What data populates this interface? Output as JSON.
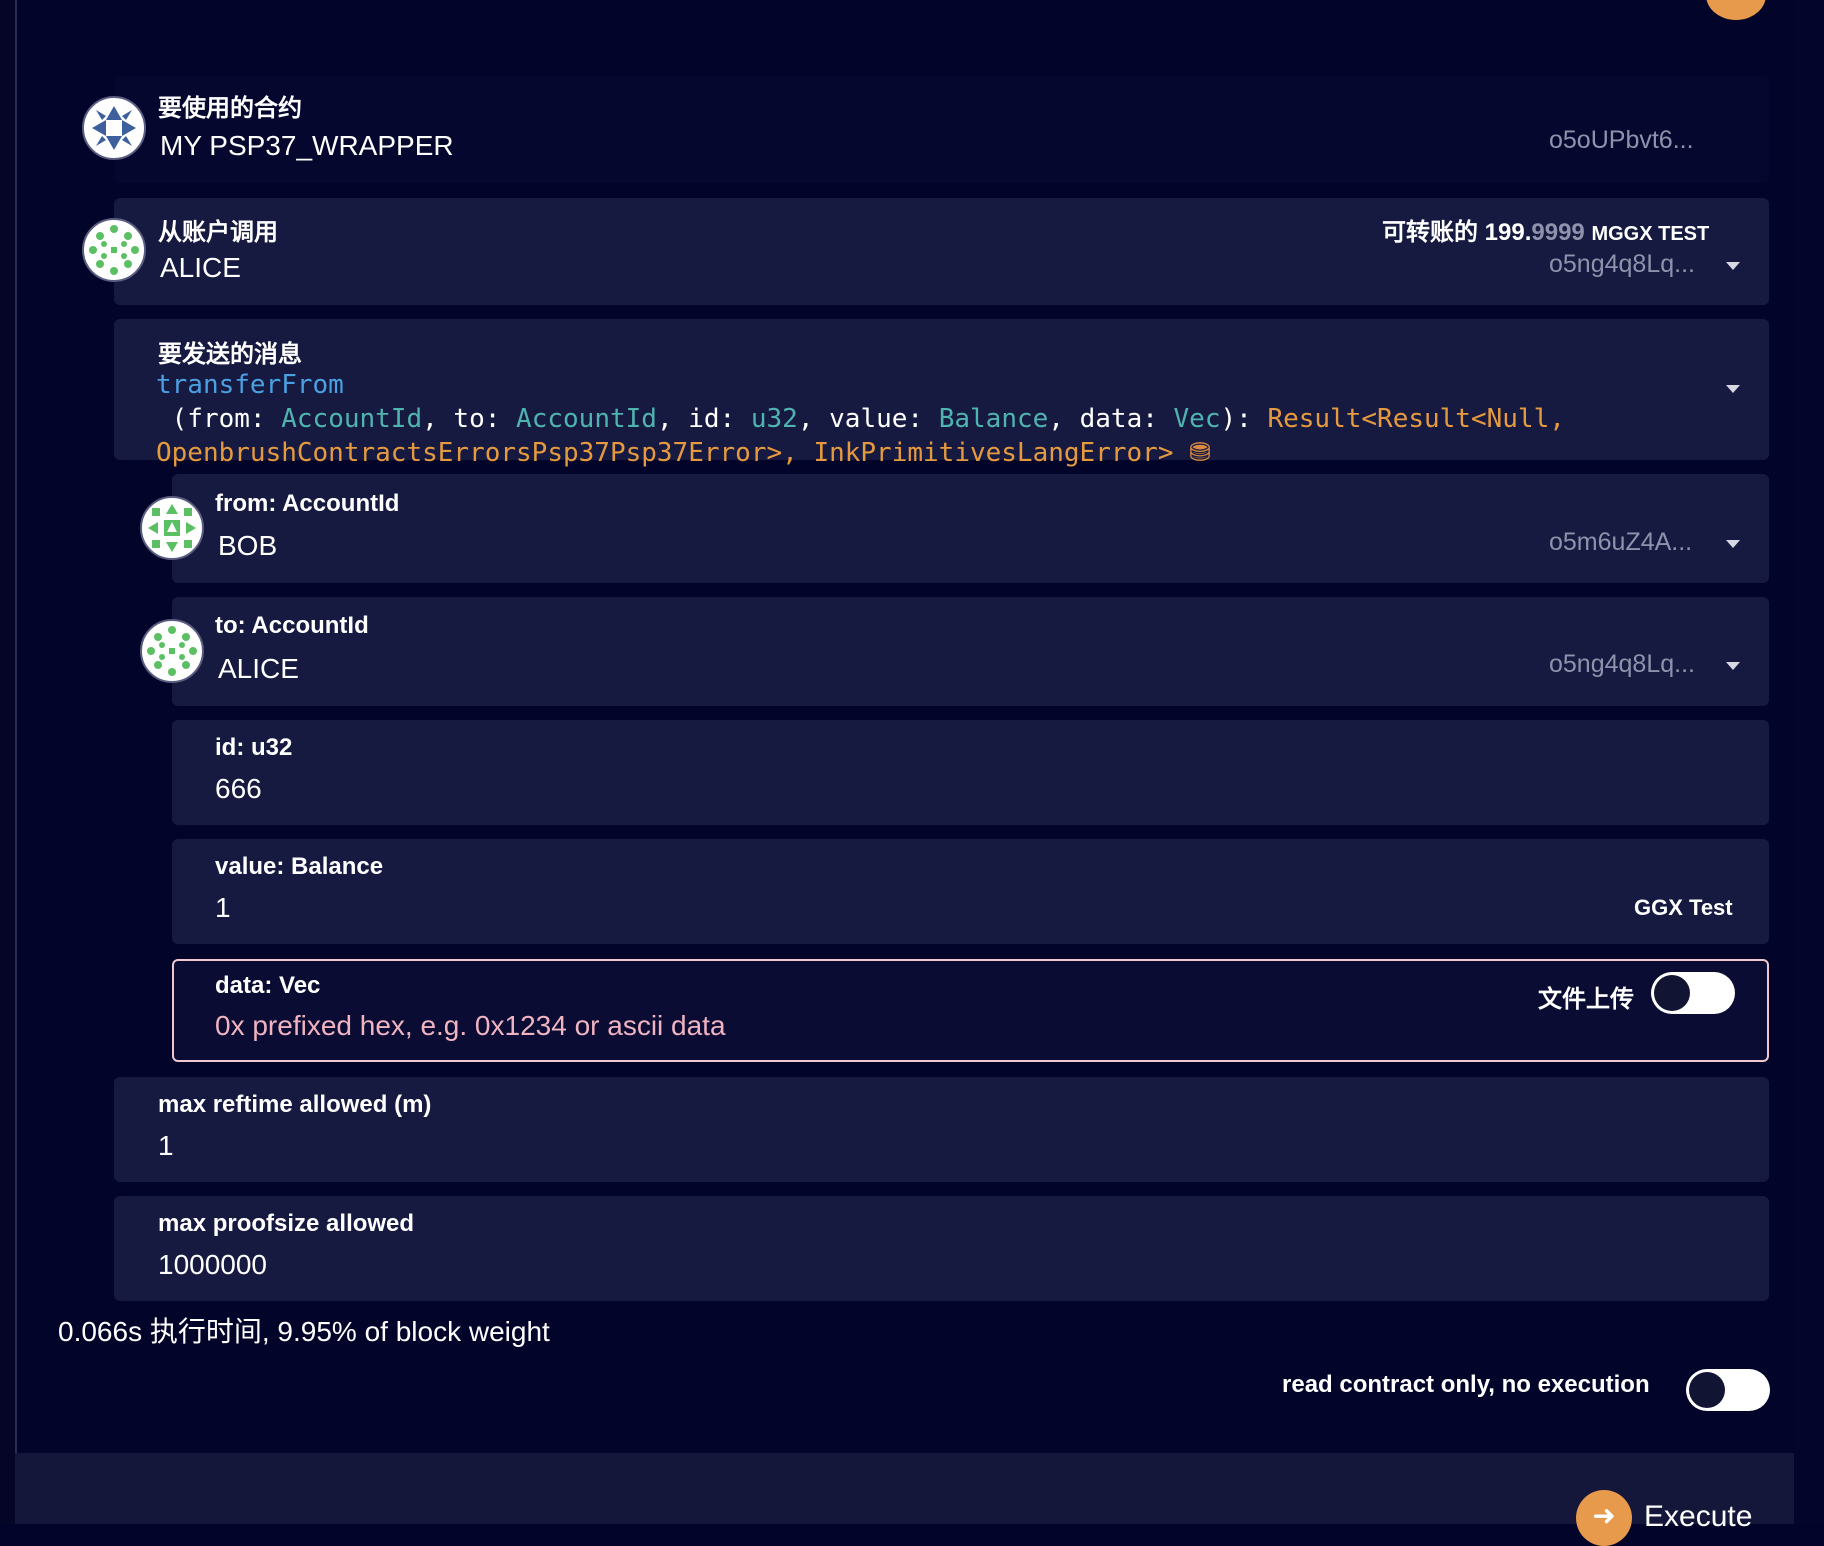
{
  "contract": {
    "label": "要使用的合约",
    "name": "MY PSP37_WRAPPER",
    "address": "o5oUPbvt6..."
  },
  "caller": {
    "label": "从账户调用",
    "name": "ALICE",
    "address": "o5ng4q8Lq...",
    "balance_label": "可转账的",
    "balance_int": "199.",
    "balance_dec": "9999",
    "balance_unit": "MGGX TEST"
  },
  "message": {
    "label": "要发送的消息",
    "signature": {
      "fn": "transferFrom",
      "open": " (from: ",
      "t1": "AccountId",
      "s1": ", to: ",
      "t2": "AccountId",
      "s2": ", id: ",
      "t3": "u32",
      "s3": ", value: ",
      "t4": "Balance",
      "s4": ", data: ",
      "t5": "Vec",
      "s5": "): ",
      "ret1": "Result<Result<Null,",
      "ret2": "OpenbrushContractsErrorsPsp37Psp37Error>, InkPrimitivesLangError>",
      "coin": "⛃"
    }
  },
  "params": {
    "from": {
      "label": "from: AccountId",
      "name": "BOB",
      "address": "o5m6uZ4A..."
    },
    "to": {
      "label": "to: AccountId",
      "name": "ALICE",
      "address": "o5ng4q8Lq..."
    },
    "id": {
      "label": "id: u32",
      "value": "666"
    },
    "value": {
      "label": "value: Balance",
      "value": "1",
      "unit": "GGX Test"
    },
    "data": {
      "label": "data: Vec",
      "placeholder": "0x prefixed hex, e.g. 0x1234 or ascii data",
      "upload_label": "文件上传",
      "upload_on": false
    }
  },
  "limits": {
    "reftime": {
      "label": "max reftime allowed (m)",
      "value": "1"
    },
    "proofsize": {
      "label": "max proofsize allowed",
      "value": "1000000"
    }
  },
  "estimate": "0.066s 执行时间, 9.95% of block weight",
  "read_only": {
    "label": "read contract only, no execution",
    "on": false
  },
  "execute": {
    "label": "Execute",
    "icon": "login-arrow-icon"
  },
  "colors": {
    "background": "#03042a",
    "row": "#161a40",
    "accent": "#e79a4b",
    "type": "#4fb3b0",
    "fn": "#4aa0e0",
    "return": "#e69a3f",
    "placeholder": "#f0b3c0"
  }
}
